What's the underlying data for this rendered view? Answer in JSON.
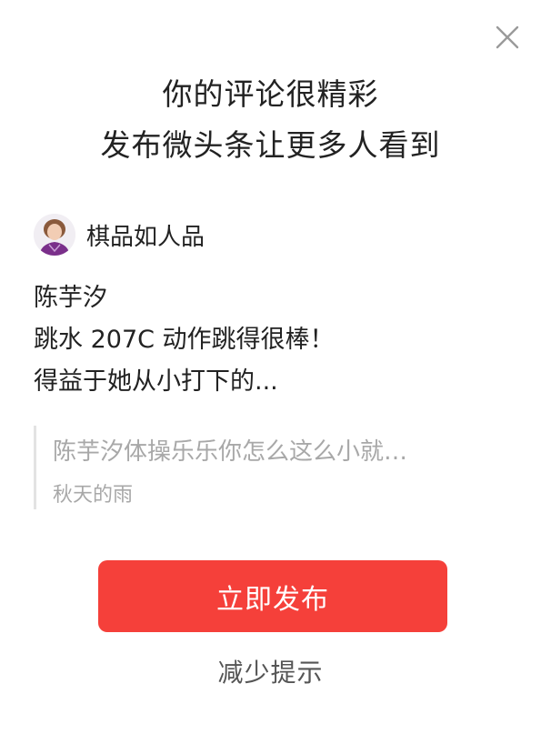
{
  "dialog": {
    "close_icon": "close-icon",
    "headline_line1": "你的评论很精彩",
    "headline_line2": "发布微头条让更多人看到"
  },
  "author": {
    "avatar_icon": "avatar",
    "name": "棋品如人品"
  },
  "post": {
    "line1": "陈芋汐",
    "line2": "跳水 207C 动作跳得很棒！",
    "line3": "得益于她从小打下的..."
  },
  "quote": {
    "text": "陈芋汐体操乐乐你怎么这么小就…",
    "author": "秋天的雨"
  },
  "actions": {
    "publish_label": "立即发布",
    "reduce_label": "减少提示"
  },
  "colors": {
    "primary": "#f5403a",
    "text": "#222222",
    "muted": "#a8a8a8",
    "secondary": "#555555"
  }
}
